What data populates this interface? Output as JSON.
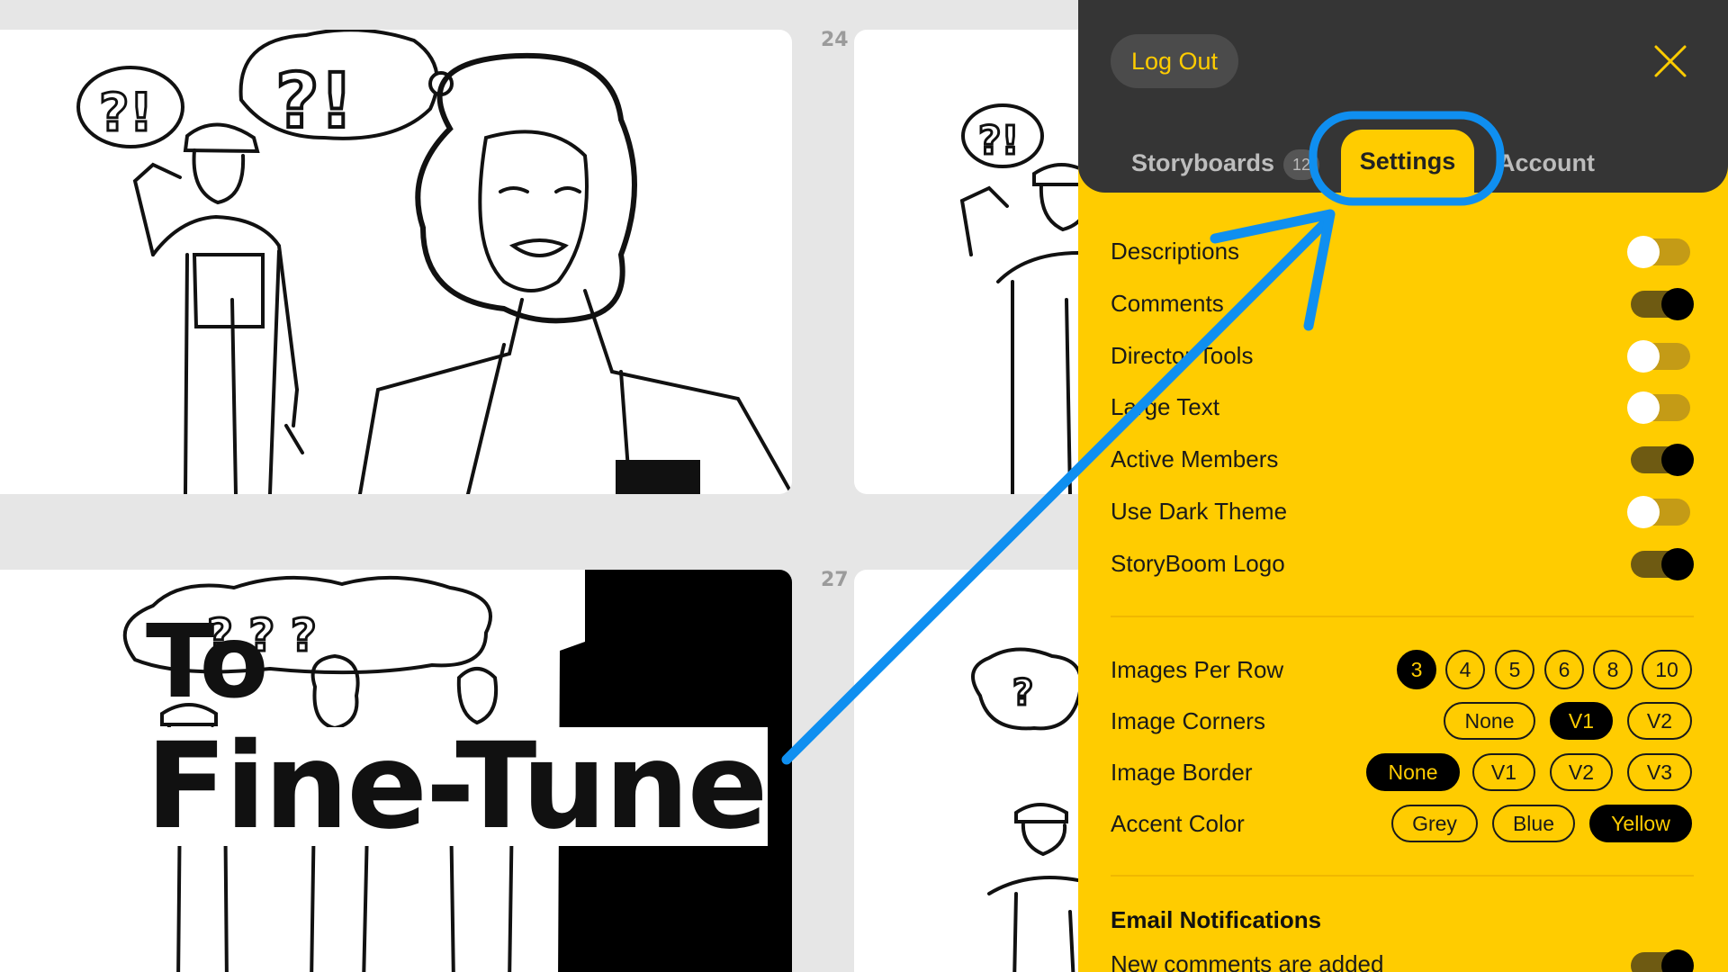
{
  "storyboard": {
    "frame_numbers": [
      "24",
      "27"
    ],
    "overlay_title": {
      "line1": "To",
      "line2": "Fine-Tune"
    }
  },
  "panel": {
    "logout_label": "Log Out",
    "close_icon": "close-x-icon",
    "tabs": [
      {
        "label": "Storyboards",
        "count": "12"
      },
      {
        "label": "Settings",
        "active": true
      },
      {
        "label": "Account"
      }
    ],
    "toggles": [
      {
        "label": "Descriptions",
        "on": false
      },
      {
        "label": "Comments",
        "on": true
      },
      {
        "label": "Director Tools",
        "on": false
      },
      {
        "label": "Large Text",
        "on": false
      },
      {
        "label": "Active Members",
        "on": true
      },
      {
        "label": "Use Dark Theme",
        "on": false
      },
      {
        "label": "StoryBoom Logo",
        "on": true
      }
    ],
    "images_per_row": {
      "label": "Images Per Row",
      "options": [
        "3",
        "4",
        "5",
        "6",
        "8",
        "10"
      ],
      "selected": "3"
    },
    "image_corners": {
      "label": "Image Corners",
      "options": [
        "None",
        "V1",
        "V2"
      ],
      "selected": "V1"
    },
    "image_border": {
      "label": "Image Border",
      "options": [
        "None",
        "V1",
        "V2",
        "V3"
      ],
      "selected": "None"
    },
    "accent_color": {
      "label": "Accent Color",
      "options": [
        "Grey",
        "Blue",
        "Yellow"
      ],
      "selected": "Yellow"
    },
    "email_notifications": {
      "heading": "Email Notifications",
      "items": [
        {
          "label": "New comments are added",
          "on": true
        }
      ]
    }
  },
  "colors": {
    "accent": "#ffcc00",
    "panel_dark": "#353535",
    "annotation_blue": "#0f8ff0"
  }
}
